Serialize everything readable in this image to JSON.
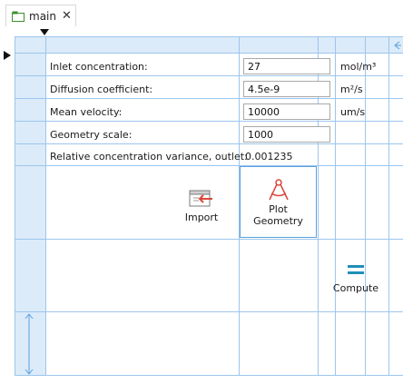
{
  "tabs": [
    {
      "label": "main",
      "close": "✕"
    }
  ],
  "form": {
    "rows": [
      {
        "label": "Inlet concentration:",
        "value": "27",
        "unit": "mol/m³"
      },
      {
        "label": "Diffusion coefficient:",
        "value": "4.5e-9",
        "unit": "m²/s"
      },
      {
        "label": "Mean velocity:",
        "value": "10000",
        "unit": "um/s"
      },
      {
        "label": "Geometry scale:",
        "value": "1000",
        "unit": ""
      }
    ],
    "result": {
      "label": "Relative concentration variance, outlet:",
      "value": "0.001235"
    }
  },
  "buttons": {
    "import": "Import",
    "plot_geometry": "Plot\nGeometry",
    "compute": "Compute"
  },
  "colors": {
    "grid_line": "#9cc6ee",
    "grid_band": "#dcebf9",
    "accent_red": "#d9473a",
    "accent_teal": "#1f8fb8"
  }
}
